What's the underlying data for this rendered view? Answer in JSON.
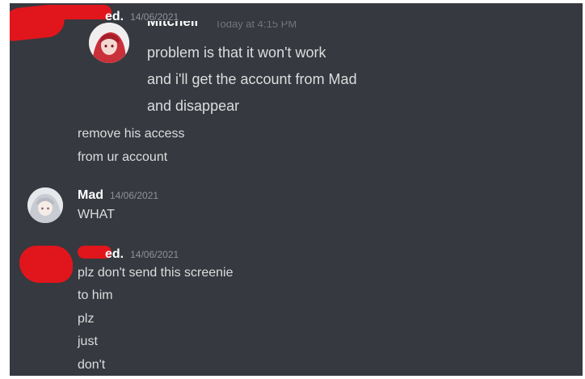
{
  "colors": {
    "background": "#36393f",
    "username": "#ffffff",
    "message_text": "#dcddde",
    "timestamp": "#8e9297",
    "redaction": "#e0161c"
  },
  "messages": [
    {
      "author": "ed.",
      "timestamp": "14/06/2021",
      "quote": {
        "author": "Mitchell",
        "timestamp": "Today at 4:15 PM",
        "lines": [
          "problem is that it won't work",
          "and i'll get the account from Mad",
          "and disappear"
        ]
      },
      "lines": [
        "remove his access",
        "from ur account"
      ]
    },
    {
      "author": "Mad",
      "timestamp": "14/06/2021",
      "lines": [
        "WHAT"
      ]
    },
    {
      "author": "ed.",
      "timestamp": "14/06/2021",
      "lines": [
        "plz don't send this screenie",
        "to him",
        "plz",
        "just",
        "don't"
      ]
    }
  ]
}
